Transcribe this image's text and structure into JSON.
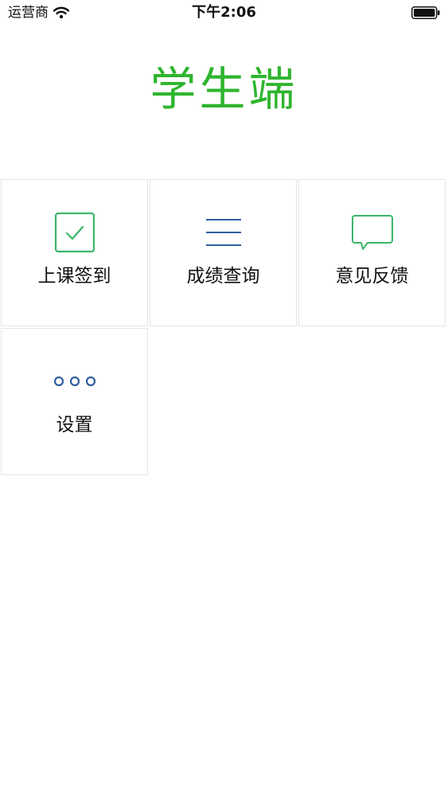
{
  "status_bar": {
    "carrier": "运营商",
    "time": "下午2:06"
  },
  "header": {
    "title": "学生端"
  },
  "colors": {
    "title_green": "#2fb52f",
    "icon_green": "#3cb56a",
    "icon_blue": "#2f5f9f",
    "border": "#e4e4e4"
  },
  "tiles": [
    {
      "label": "上课签到",
      "icon": "checkbox-icon"
    },
    {
      "label": "成绩查询",
      "icon": "list-lines-icon"
    },
    {
      "label": "意见反馈",
      "icon": "chat-bubble-icon"
    },
    {
      "label": "设置",
      "icon": "more-dots-icon"
    }
  ]
}
